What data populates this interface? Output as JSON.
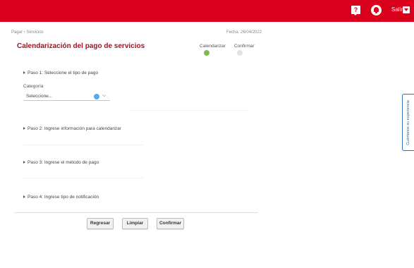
{
  "header": {
    "help_icon": "question-chat-icon",
    "help_glyph": "?",
    "notifications_icon": "bell-icon",
    "logout_label": "Salir",
    "logout_icon": "exit-arrow-icon",
    "brand_color": "#d9001b"
  },
  "breadcrumb": "Pagar › Servicios",
  "fecha": "Fecha: 26/04/2022",
  "page_title": "Calendarización del pago de servicios",
  "stepper": [
    {
      "label": "Calendarizar",
      "active": true,
      "color": "#7dbb52"
    },
    {
      "label": "Confirmar",
      "active": false,
      "color": "#e4e4e4"
    }
  ],
  "sections": [
    "Paso 1: Seleccione el tipo de pago",
    "Paso 2: Ingrese información para calendarizar",
    "Paso 3: Ingrese el método de pago",
    "Paso 4: Ingrese tipo de notificación"
  ],
  "category": {
    "label": "Categoría",
    "value": "Seleccione..."
  },
  "buttons": {
    "back": "Regresar",
    "clear": "Limpiar",
    "confirm": "Confirmar"
  },
  "feedback_tab": "Cuéntanos su experiencia"
}
